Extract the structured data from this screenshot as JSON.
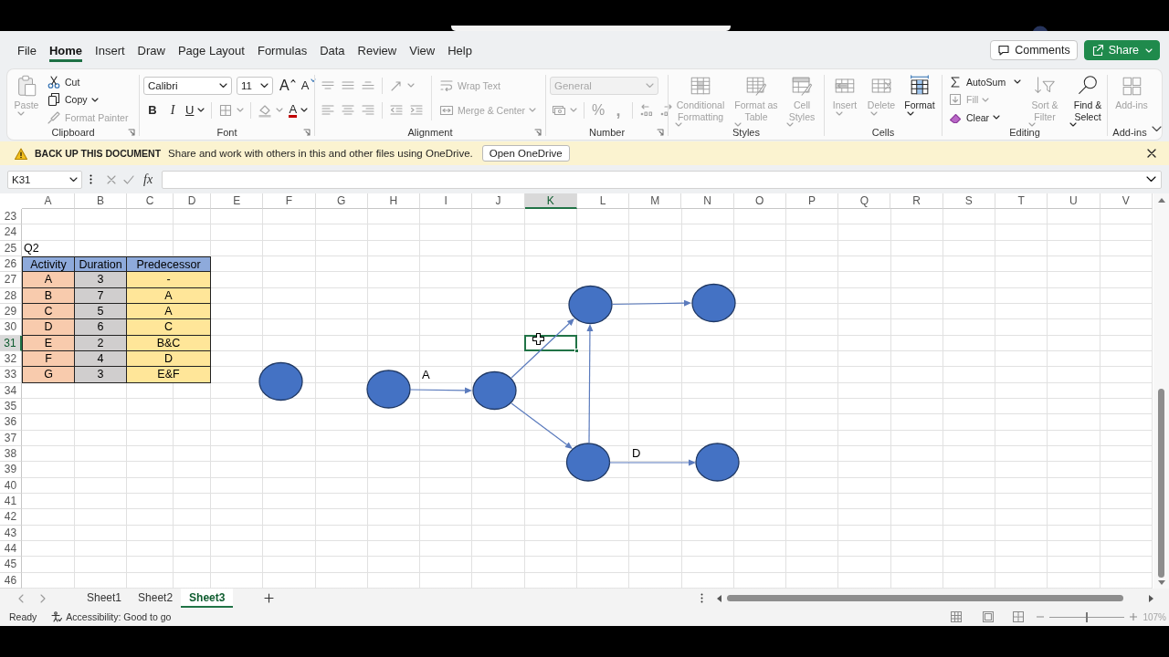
{
  "tabs": [
    {
      "label": "File",
      "selected": false
    },
    {
      "label": "Home",
      "selected": true
    },
    {
      "label": "Insert",
      "selected": false
    },
    {
      "label": "Draw",
      "selected": false
    },
    {
      "label": "Page Layout",
      "selected": false
    },
    {
      "label": "Formulas",
      "selected": false
    },
    {
      "label": "Data",
      "selected": false
    },
    {
      "label": "Review",
      "selected": false
    },
    {
      "label": "View",
      "selected": false
    },
    {
      "label": "Help",
      "selected": false
    }
  ],
  "header_buttons": [
    {
      "label": "Comments",
      "kind": "outline",
      "menu": false
    },
    {
      "label": "Share",
      "kind": "primary",
      "menu": true
    }
  ],
  "ribbon": {
    "groups": [
      {
        "label": "Clipboard",
        "launcher": true,
        "controls": [
          {
            "kind": "large",
            "label": "Paste",
            "disabled": true,
            "menu": true
          },
          {
            "kind": "small",
            "label": "Cut",
            "disabled": false,
            "menu": false
          },
          {
            "kind": "small",
            "label": "Copy",
            "disabled": false,
            "menu": true
          },
          {
            "kind": "small",
            "label": "Format Painter",
            "disabled": true,
            "menu": false
          }
        ]
      },
      {
        "label": "Font",
        "launcher": true,
        "controls": [
          {
            "kind": "combo",
            "value": "Calibri",
            "disabled": false,
            "menu": true
          },
          {
            "kind": "combo",
            "value": "11",
            "disabled": false,
            "menu": true
          },
          {
            "kind": "glyph",
            "label": "A",
            "disabled": false,
            "menu": false
          },
          {
            "kind": "glyph",
            "label": "A",
            "disabled": false,
            "menu": false
          },
          {
            "kind": "glyph",
            "label": "B",
            "disabled": false,
            "menu": false
          },
          {
            "kind": "glyph",
            "label": "I",
            "disabled": false,
            "menu": false
          },
          {
            "kind": "glyph",
            "label": "U",
            "disabled": false,
            "menu": true
          },
          {
            "kind": "icon",
            "disabled": true,
            "menu": true
          },
          {
            "kind": "icon",
            "disabled": true,
            "menu": true
          },
          {
            "kind": "glyph",
            "label": "A",
            "disabled": false,
            "menu": true
          }
        ]
      },
      {
        "label": "Alignment",
        "launcher": true,
        "controls": [
          {
            "kind": "icon",
            "disabled": true,
            "menu": false
          },
          {
            "kind": "icon",
            "disabled": true,
            "menu": false
          },
          {
            "kind": "icon",
            "disabled": true,
            "menu": false
          },
          {
            "kind": "icon",
            "disabled": true,
            "menu": true
          },
          {
            "kind": "icon",
            "disabled": true,
            "menu": false
          },
          {
            "kind": "icon",
            "disabled": true,
            "menu": false
          },
          {
            "kind": "icon",
            "disabled": true,
            "menu": false
          },
          {
            "kind": "icon",
            "disabled": true,
            "menu": false
          },
          {
            "kind": "icon",
            "disabled": true,
            "menu": false
          },
          {
            "kind": "small",
            "label": "Wrap Text",
            "disabled": true,
            "menu": false
          },
          {
            "kind": "small",
            "label": "Merge & Center",
            "disabled": true,
            "menu": true
          }
        ]
      },
      {
        "label": "Number",
        "launcher": true,
        "controls": [
          {
            "kind": "combo",
            "value": "General",
            "disabled": true,
            "menu": true
          },
          {
            "kind": "icon",
            "disabled": true,
            "menu": true
          },
          {
            "kind": "glyph",
            "label": "%",
            "disabled": true,
            "menu": false
          },
          {
            "kind": "glyph",
            "label": ",",
            "disabled": true,
            "menu": false
          },
          {
            "kind": "icon",
            "disabled": true,
            "menu": false
          },
          {
            "kind": "icon",
            "disabled": true,
            "menu": false
          }
        ]
      },
      {
        "label": "Styles",
        "launcher": false,
        "controls": [
          {
            "kind": "large",
            "label": "Conditional Formatting",
            "disabled": true,
            "menu": true
          },
          {
            "kind": "large",
            "label": "Format as Table",
            "disabled": true,
            "menu": true
          },
          {
            "kind": "large",
            "label": "Cell Styles",
            "disabled": true,
            "menu": true
          }
        ]
      },
      {
        "label": "Cells",
        "launcher": false,
        "controls": [
          {
            "kind": "large",
            "label": "Insert",
            "disabled": true,
            "menu": true
          },
          {
            "kind": "large",
            "label": "Delete",
            "disabled": true,
            "menu": true
          },
          {
            "kind": "large",
            "label": "Format",
            "disabled": false,
            "menu": true
          }
        ]
      },
      {
        "label": "Editing",
        "launcher": false,
        "controls": [
          {
            "kind": "small",
            "label": "AutoSum",
            "disabled": false,
            "menu": true
          },
          {
            "kind": "small",
            "label": "Fill",
            "disabled": true,
            "menu": true
          },
          {
            "kind": "small",
            "label": "Clear",
            "disabled": false,
            "menu": true
          },
          {
            "kind": "large",
            "label": "Sort & Filter",
            "disabled": true,
            "menu": true
          },
          {
            "kind": "large",
            "label": "Find & Select",
            "disabled": false,
            "menu": true
          }
        ]
      },
      {
        "label": "Add-ins",
        "launcher": false,
        "controls": [
          {
            "kind": "large",
            "label": "Add-ins",
            "disabled": true,
            "menu": false
          }
        ]
      }
    ]
  },
  "notice": {
    "title": "BACK UP THIS DOCUMENT",
    "message": "Share and work with others in this and other files using OneDrive.",
    "button": "Open OneDrive"
  },
  "formula_bar": {
    "name_box": "K31",
    "function_label": "fx"
  },
  "sheet": {
    "columns": [
      {
        "label": "A",
        "selected": false
      },
      {
        "label": "B",
        "selected": false
      },
      {
        "label": "C",
        "selected": false
      },
      {
        "label": "D",
        "selected": false
      },
      {
        "label": "E",
        "selected": false
      },
      {
        "label": "F",
        "selected": false
      },
      {
        "label": "G",
        "selected": false
      },
      {
        "label": "H",
        "selected": false
      },
      {
        "label": "I",
        "selected": false
      },
      {
        "label": "J",
        "selected": false
      },
      {
        "label": "K",
        "selected": true
      },
      {
        "label": "L",
        "selected": false
      },
      {
        "label": "M",
        "selected": false
      },
      {
        "label": "N",
        "selected": false
      },
      {
        "label": "O",
        "selected": false
      },
      {
        "label": "P",
        "selected": false
      },
      {
        "label": "Q",
        "selected": false
      },
      {
        "label": "R",
        "selected": false
      },
      {
        "label": "S",
        "selected": false
      },
      {
        "label": "T",
        "selected": false
      },
      {
        "label": "U",
        "selected": false
      },
      {
        "label": "V",
        "selected": false
      }
    ],
    "rows": [
      {
        "label": "23",
        "selected": false
      },
      {
        "label": "24",
        "selected": false
      },
      {
        "label": "25",
        "selected": false
      },
      {
        "label": "26",
        "selected": false
      },
      {
        "label": "27",
        "selected": false
      },
      {
        "label": "28",
        "selected": false
      },
      {
        "label": "29",
        "selected": false
      },
      {
        "label": "30",
        "selected": false
      },
      {
        "label": "31",
        "selected": true
      },
      {
        "label": "32",
        "selected": false
      },
      {
        "label": "33",
        "selected": false
      },
      {
        "label": "34",
        "selected": false
      },
      {
        "label": "35",
        "selected": false
      },
      {
        "label": "36",
        "selected": false
      },
      {
        "label": "37",
        "selected": false
      },
      {
        "label": "38",
        "selected": false
      },
      {
        "label": "39",
        "selected": false
      },
      {
        "label": "40",
        "selected": false
      },
      {
        "label": "41",
        "selected": false
      },
      {
        "label": "42",
        "selected": false
      },
      {
        "label": "43",
        "selected": false
      },
      {
        "label": "44",
        "selected": false
      },
      {
        "label": "45",
        "selected": false
      },
      {
        "label": "46",
        "selected": false
      }
    ],
    "table": {
      "title": "Q2",
      "columns": [
        {
          "label": "Activity",
          "color": "#f8cbad"
        },
        {
          "label": "Duration",
          "color": "#d0cece"
        },
        {
          "label": "Predecessor",
          "color": "#ffe699"
        }
      ],
      "rows": [
        [
          "A",
          "3",
          "-"
        ],
        [
          "B",
          "7",
          "A"
        ],
        [
          "C",
          "5",
          "A"
        ],
        [
          "D",
          "6",
          "C"
        ],
        [
          "E",
          "2",
          "B&C"
        ],
        [
          "F",
          "4",
          "D"
        ],
        [
          "G",
          "3",
          "E&F"
        ]
      ]
    },
    "diagram": {
      "edge_labels": [
        "A",
        "D"
      ]
    }
  },
  "sheet_tabs": [
    {
      "label": "Sheet1",
      "selected": false
    },
    {
      "label": "Sheet2",
      "selected": false
    },
    {
      "label": "Sheet3",
      "selected": true
    }
  ],
  "status_bar": {
    "status": "Ready",
    "accessibility": "Accessibility: Good to go",
    "zoom": {
      "level": 0.5,
      "reading": "107%"
    }
  }
}
